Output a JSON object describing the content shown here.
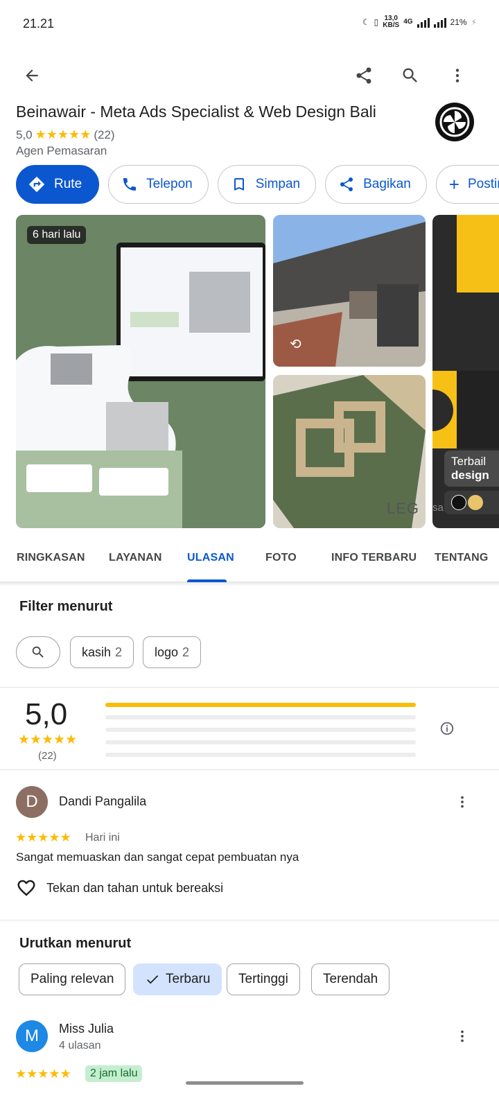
{
  "status": {
    "time": "21.21",
    "net_speed_value": "13,0",
    "net_speed_unit": "KB/S",
    "network_type": "4G",
    "battery": "21%"
  },
  "place": {
    "name": "Beinawair - Meta Ads Specialist & Web Design Bali",
    "rating": "5,0",
    "stars": "★★★★★",
    "review_count": "(22)",
    "category": "Agen Pemasaran"
  },
  "actions": {
    "route": "Rute",
    "call": "Telepon",
    "save": "Simpan",
    "share": "Bagikan",
    "post": "Postin"
  },
  "photos": {
    "badge": "6 hari lalu",
    "side_text_1": "Terbail",
    "side_text_2": "design",
    "side_partial": "sa",
    "watermark": "LEG"
  },
  "tabs": [
    "RINGKASAN",
    "LAYANAN",
    "ULASAN",
    "FOTO",
    "INFO TERBARU",
    "TENTANG"
  ],
  "filter": {
    "title": "Filter menurut",
    "chips": [
      {
        "label": "kasih",
        "count": "2"
      },
      {
        "label": "logo",
        "count": "2"
      }
    ]
  },
  "summary": {
    "rating": "5,0",
    "stars": "★★★★★",
    "count": "(22)",
    "distribution": [
      1.0,
      0,
      0,
      0,
      0
    ]
  },
  "reviews": [
    {
      "initial": "D",
      "name": "Dandi Pangalila",
      "stars": "★★★★★",
      "time": "Hari ini",
      "text": "Sangat memuaskan dan sangat cepat pembuatan nya",
      "react": "Tekan dan tahan untuk bereaksi",
      "avatar_color": "#8d6e63"
    },
    {
      "initial": "M",
      "name": "Miss Julia",
      "sub": "4 ulasan",
      "stars": "★★★★★",
      "time": "2 jam lalu",
      "avatar_color": "#1e88e5"
    }
  ],
  "sort": {
    "title": "Urutkan menurut",
    "options": [
      "Paling relevan",
      "Terbaru",
      "Tertinggi",
      "Terendah"
    ],
    "selected": "Terbaru"
  },
  "colors": {
    "accent": "#0b57d0",
    "star": "#fbbc04"
  }
}
